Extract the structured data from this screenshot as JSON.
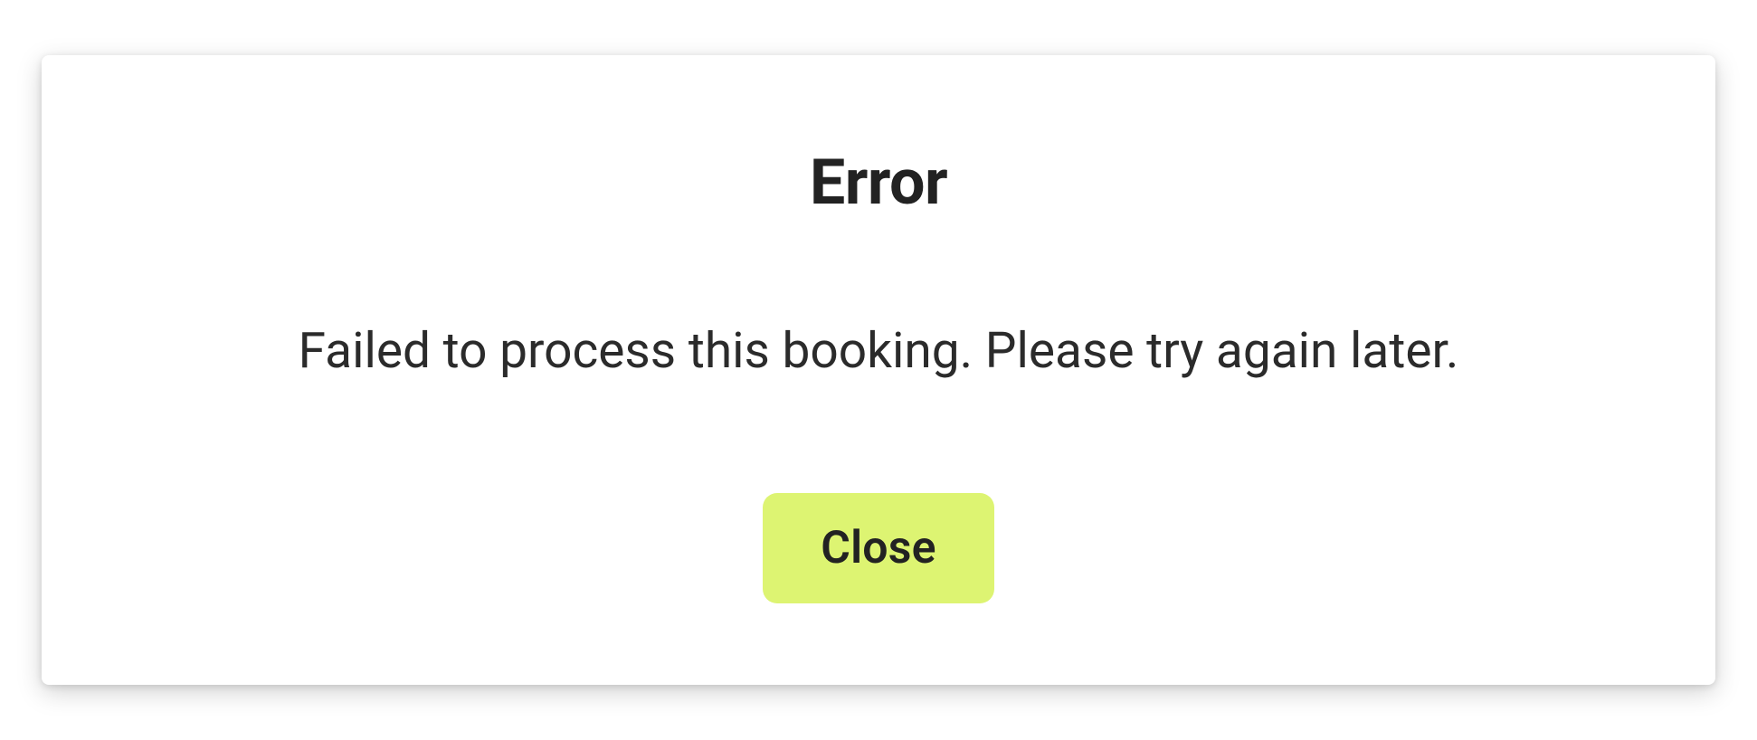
{
  "dialog": {
    "title": "Error",
    "message": "Failed to process this booking. Please try again later.",
    "close_label": "Close"
  },
  "colors": {
    "accent": "#DDF472",
    "text_primary": "#222222"
  }
}
